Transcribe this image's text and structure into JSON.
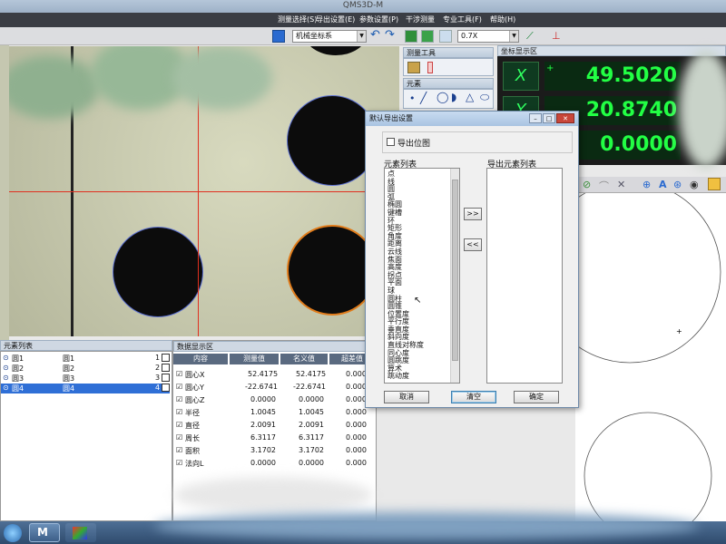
{
  "window": {
    "title": "QMS3D-M"
  },
  "menu": [
    "测量选择(S)",
    "导出设置(E)",
    "参数设置(P)",
    "干涉测量",
    "专业工具(F)",
    "帮助(H)"
  ],
  "toolbar": {
    "coord_system": "机械坐标系",
    "zoom": "0.7X"
  },
  "measure_tools": {
    "title": "测量工具",
    "elements_title": "元素"
  },
  "coord_panel": {
    "title": "坐标显示区",
    "axes": [
      {
        "icon": "X",
        "value": "49.5020",
        "sign": "+"
      },
      {
        "icon": "Y",
        "value": "20.8740",
        "sign": ""
      },
      {
        "icon": "Z",
        "value": "0.0000",
        "sign": ""
      }
    ]
  },
  "element_list": {
    "title": "元素列表",
    "rows": [
      {
        "a": "圆1",
        "b": "圆1",
        "n": "1"
      },
      {
        "a": "圆2",
        "b": "圆2",
        "n": "2"
      },
      {
        "a": "圆3",
        "b": "圆3",
        "n": "3"
      },
      {
        "a": "圆4",
        "b": "圆4",
        "n": "4"
      }
    ]
  },
  "data_panel": {
    "title": "数据显示区",
    "headers": [
      "内容",
      "测量值",
      "名义值",
      "超差值"
    ],
    "rows": [
      {
        "label": "圆心X",
        "measured": "52.4175",
        "nominal": "52.4175",
        "tol": "0.000"
      },
      {
        "label": "圆心Y",
        "measured": "-22.6741",
        "nominal": "-22.6741",
        "tol": "0.000"
      },
      {
        "label": "圆心Z",
        "measured": "0.0000",
        "nominal": "0.0000",
        "tol": "0.000"
      },
      {
        "label": "半径",
        "measured": "1.0045",
        "nominal": "1.0045",
        "tol": "0.000"
      },
      {
        "label": "直径",
        "measured": "2.0091",
        "nominal": "2.0091",
        "tol": "0.000"
      },
      {
        "label": "周长",
        "measured": "6.3117",
        "nominal": "6.3117",
        "tol": "0.000"
      },
      {
        "label": "面积",
        "measured": "3.1702",
        "nominal": "3.1702",
        "tol": "0.000"
      },
      {
        "label": "法向L",
        "measured": "0.0000",
        "nominal": "0.0000",
        "tol": "0.000"
      }
    ]
  },
  "dialog": {
    "title": "默认导出设置",
    "checkbox_label": "导出位图",
    "element_list_label": "元素列表",
    "export_list_label": "导出元素列表",
    "elements": [
      "点",
      "线",
      "圆",
      "弧",
      "椭圆",
      "键槽",
      "环",
      "矩形",
      "角度",
      "距离",
      "云线",
      "焦面",
      "高度",
      "拐点",
      "平面",
      "球",
      "圆柱",
      "圆锥",
      "位置度",
      "平行度",
      "垂直度",
      "斜向度",
      "直线对称度",
      "同心度",
      "圆跳度",
      "算术",
      "跳动度"
    ],
    "add_btn": ">>",
    "remove_btn": "<<",
    "cancel": "取消",
    "clear": "清空",
    "ok": "确定"
  }
}
